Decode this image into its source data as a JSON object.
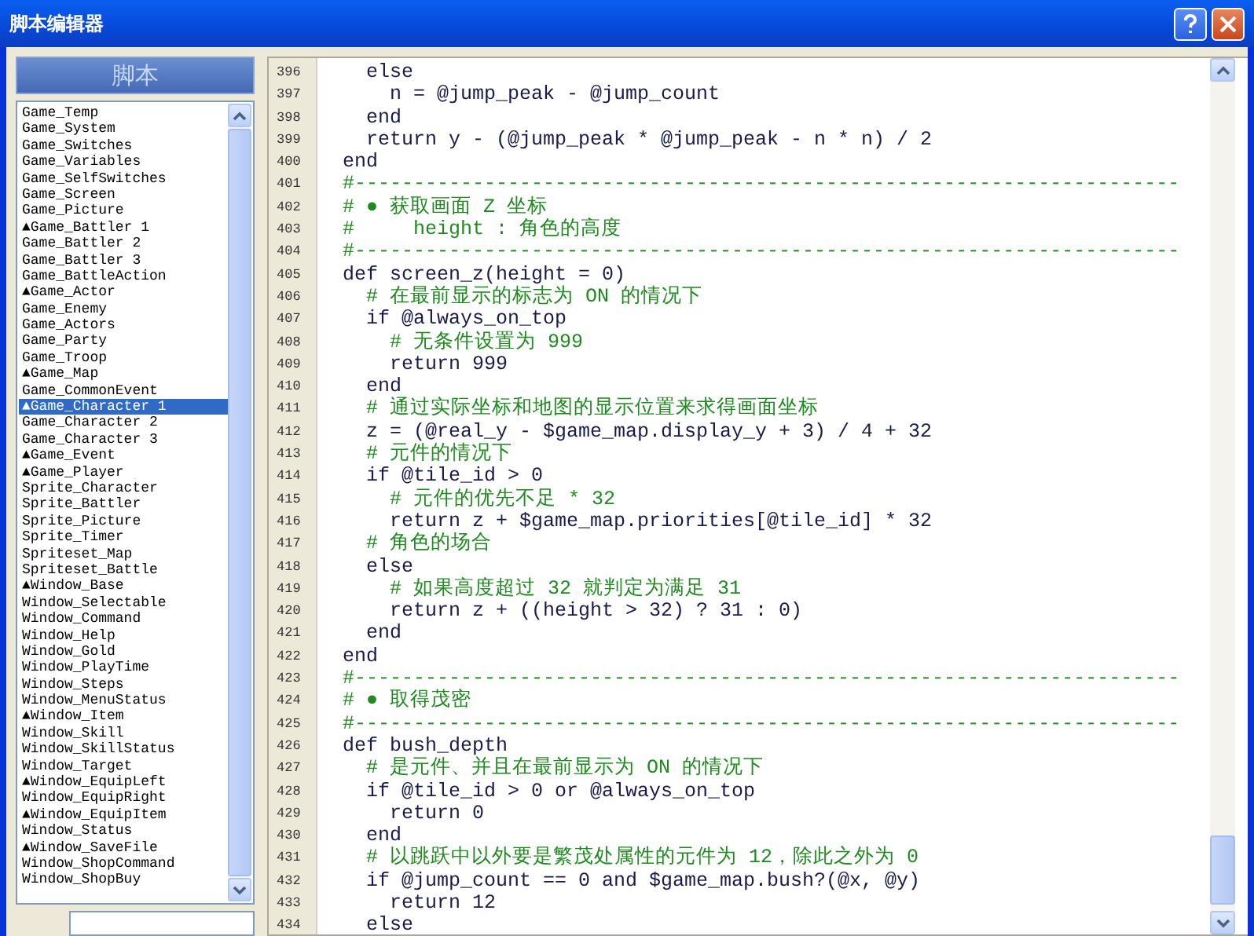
{
  "window": {
    "title": "脚本编辑器"
  },
  "sidebar": {
    "header": "脚本",
    "items": [
      {
        "label": "Game_Temp",
        "selected": false
      },
      {
        "label": "Game_System",
        "selected": false
      },
      {
        "label": "Game_Switches",
        "selected": false
      },
      {
        "label": "Game_Variables",
        "selected": false
      },
      {
        "label": "Game_SelfSwitches",
        "selected": false
      },
      {
        "label": "Game_Screen",
        "selected": false
      },
      {
        "label": "Game_Picture",
        "selected": false
      },
      {
        "label": "▲Game_Battler 1",
        "selected": false
      },
      {
        "label": "Game_Battler 2",
        "selected": false
      },
      {
        "label": "Game_Battler 3",
        "selected": false
      },
      {
        "label": "Game_BattleAction",
        "selected": false
      },
      {
        "label": "▲Game_Actor",
        "selected": false
      },
      {
        "label": "Game_Enemy",
        "selected": false
      },
      {
        "label": "Game_Actors",
        "selected": false
      },
      {
        "label": "Game_Party",
        "selected": false
      },
      {
        "label": "Game_Troop",
        "selected": false
      },
      {
        "label": "▲Game_Map",
        "selected": false
      },
      {
        "label": "Game_CommonEvent",
        "selected": false
      },
      {
        "label": "▲Game_Character 1",
        "selected": true
      },
      {
        "label": "Game_Character 2",
        "selected": false
      },
      {
        "label": "Game_Character 3",
        "selected": false
      },
      {
        "label": "▲Game_Event",
        "selected": false
      },
      {
        "label": "▲Game_Player",
        "selected": false
      },
      {
        "label": "Sprite_Character",
        "selected": false
      },
      {
        "label": "Sprite_Battler",
        "selected": false
      },
      {
        "label": "Sprite_Picture",
        "selected": false
      },
      {
        "label": "Sprite_Timer",
        "selected": false
      },
      {
        "label": "Spriteset_Map",
        "selected": false
      },
      {
        "label": "Spriteset_Battle",
        "selected": false
      },
      {
        "label": "▲Window_Base",
        "selected": false
      },
      {
        "label": "Window_Selectable",
        "selected": false
      },
      {
        "label": "Window_Command",
        "selected": false
      },
      {
        "label": "Window_Help",
        "selected": false
      },
      {
        "label": "Window_Gold",
        "selected": false
      },
      {
        "label": "Window_PlayTime",
        "selected": false
      },
      {
        "label": "Window_Steps",
        "selected": false
      },
      {
        "label": "Window_MenuStatus",
        "selected": false
      },
      {
        "label": "▲Window_Item",
        "selected": false
      },
      {
        "label": "Window_Skill",
        "selected": false
      },
      {
        "label": "Window_SkillStatus",
        "selected": false
      },
      {
        "label": "Window_Target",
        "selected": false
      },
      {
        "label": "▲Window_EquipLeft",
        "selected": false
      },
      {
        "label": "Window_EquipRight",
        "selected": false
      },
      {
        "label": "▲Window_EquipItem",
        "selected": false
      },
      {
        "label": "Window_Status",
        "selected": false
      },
      {
        "label": "▲Window_SaveFile",
        "selected": false
      },
      {
        "label": "Window_ShopCommand",
        "selected": false
      },
      {
        "label": "Window_ShopBuy",
        "selected": false
      }
    ]
  },
  "editor": {
    "lines": [
      {
        "number": "396",
        "kind": "code",
        "text": "  else"
      },
      {
        "number": "397",
        "kind": "code",
        "text": "    n = @jump_peak - @jump_count"
      },
      {
        "number": "398",
        "kind": "code",
        "text": "  end"
      },
      {
        "number": "399",
        "kind": "code",
        "text": "  return y - (@jump_peak * @jump_peak - n * n) / 2"
      },
      {
        "number": "400",
        "kind": "code",
        "text": "end"
      },
      {
        "number": "401",
        "kind": "comment",
        "text": "#----------------------------------------------------------------------"
      },
      {
        "number": "402",
        "kind": "comment",
        "text": "# ● 获取画面 Z 坐标"
      },
      {
        "number": "403",
        "kind": "comment",
        "text": "#     height : 角色的高度"
      },
      {
        "number": "404",
        "kind": "comment",
        "text": "#----------------------------------------------------------------------"
      },
      {
        "number": "405",
        "kind": "code",
        "text": "def screen_z(height = 0)"
      },
      {
        "number": "406",
        "kind": "comment",
        "text": "  # 在最前显示的标志为 ON 的情况下"
      },
      {
        "number": "407",
        "kind": "code",
        "text": "  if @always_on_top"
      },
      {
        "number": "408",
        "kind": "comment",
        "text": "    # 无条件设置为 999"
      },
      {
        "number": "409",
        "kind": "code",
        "text": "    return 999"
      },
      {
        "number": "410",
        "kind": "code",
        "text": "  end"
      },
      {
        "number": "411",
        "kind": "comment",
        "text": "  # 通过实际坐标和地图的显示位置来求得画面坐标"
      },
      {
        "number": "412",
        "kind": "code",
        "text": "  z = (@real_y - $game_map.display_y + 3) / 4 + 32"
      },
      {
        "number": "413",
        "kind": "comment",
        "text": "  # 元件的情况下"
      },
      {
        "number": "414",
        "kind": "code",
        "text": "  if @tile_id > 0"
      },
      {
        "number": "415",
        "kind": "comment",
        "text": "    # 元件的优先不足 * 32"
      },
      {
        "number": "416",
        "kind": "code",
        "text": "    return z + $game_map.priorities[@tile_id] * 32"
      },
      {
        "number": "417",
        "kind": "comment",
        "text": "  # 角色的场合"
      },
      {
        "number": "418",
        "kind": "code",
        "text": "  else"
      },
      {
        "number": "419",
        "kind": "comment",
        "text": "    # 如果高度超过 32 就判定为满足 31"
      },
      {
        "number": "420",
        "kind": "code",
        "text": "    return z + ((height > 32) ? 31 : 0)"
      },
      {
        "number": "421",
        "kind": "code",
        "text": "  end"
      },
      {
        "number": "422",
        "kind": "code",
        "text": "end"
      },
      {
        "number": "423",
        "kind": "comment",
        "text": "#----------------------------------------------------------------------"
      },
      {
        "number": "424",
        "kind": "comment",
        "text": "# ● 取得茂密"
      },
      {
        "number": "425",
        "kind": "comment",
        "text": "#----------------------------------------------------------------------"
      },
      {
        "number": "426",
        "kind": "code",
        "text": "def bush_depth"
      },
      {
        "number": "427",
        "kind": "comment",
        "text": "  # 是元件、并且在最前显示为 ON 的情况下"
      },
      {
        "number": "428",
        "kind": "code",
        "text": "  if @tile_id > 0 or @always_on_top"
      },
      {
        "number": "429",
        "kind": "code",
        "text": "    return 0"
      },
      {
        "number": "430",
        "kind": "code",
        "text": "  end"
      },
      {
        "number": "431",
        "kind": "comment",
        "text": "  # 以跳跃中以外要是繁茂处属性的元件为 12，除此之外为 0"
      },
      {
        "number": "432",
        "kind": "code",
        "text": "  if @jump_count == 0 and $game_map.bush?(@x, @y)"
      },
      {
        "number": "433",
        "kind": "code",
        "text": "    return 12"
      },
      {
        "number": "434",
        "kind": "code",
        "text": "  else"
      }
    ]
  }
}
